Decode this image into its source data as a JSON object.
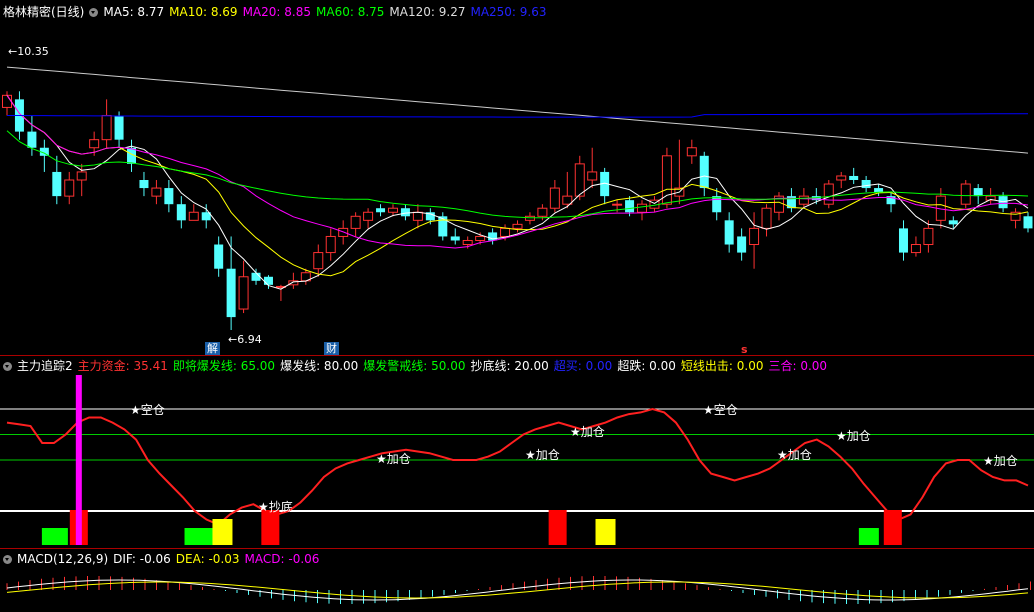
{
  "colors": {
    "bg": "#000000",
    "up": "#ff3232",
    "down": "#54ffff",
    "ma5": "#ffffff",
    "ma10": "#ffff00",
    "ma20": "#ff00ff",
    "ma60": "#00ff00",
    "ma120": "#cccccc",
    "ma250": "#0000ff",
    "divider": "#aa0000"
  },
  "main_header": {
    "name": "格林精密(日线)",
    "ma5": "MA5: 8.77",
    "ma10": "MA10: 8.69",
    "ma20": "MA20: 8.85",
    "ma60": "MA60: 8.75",
    "ma120": "MA120: 9.27",
    "ma250": "MA250: 9.63"
  },
  "main_labels": {
    "high": "10.35",
    "low": "6.94",
    "tag1": "解",
    "tag2": "财",
    "tag3": "s"
  },
  "ind_header": {
    "name": "主力追踪2",
    "zlzj": "主力资金: 35.41",
    "jjbfx": "即将爆发线: 65.00",
    "bfx": "爆发线: 80.00",
    "bfjjx": "爆发警戒线: 50.00",
    "cdx": "抄底线: 20.00",
    "cm": "超买: 0.00",
    "cd": "超跌: 0.00",
    "dxcj": "短线出击: 0.00",
    "sh": "三合: 0.00"
  },
  "macd_header": {
    "name": "MACD(12,26,9)",
    "dif": "DIF: -0.06",
    "dea": "DEA: -0.03",
    "macd": "MACD: -0.06"
  },
  "chart_data": [
    {
      "type": "candlestick",
      "title": "格林精密(日线)",
      "ylim": [
        6.94,
        10.35
      ],
      "candles": [
        [
          9.7,
          9.9,
          9.6,
          9.85
        ],
        [
          9.8,
          9.9,
          9.3,
          9.4
        ],
        [
          9.4,
          9.6,
          9.1,
          9.2
        ],
        [
          9.2,
          9.3,
          8.9,
          9.1
        ],
        [
          8.9,
          9.1,
          8.5,
          8.6
        ],
        [
          8.6,
          8.9,
          8.5,
          8.8
        ],
        [
          8.8,
          9.0,
          8.6,
          8.9
        ],
        [
          9.2,
          9.4,
          9.1,
          9.3
        ],
        [
          9.3,
          9.8,
          9.2,
          9.6
        ],
        [
          9.6,
          9.65,
          9.2,
          9.3
        ],
        [
          9.2,
          9.3,
          8.9,
          9.0
        ],
        [
          8.8,
          8.9,
          8.6,
          8.7
        ],
        [
          8.6,
          8.8,
          8.5,
          8.7
        ],
        [
          8.7,
          8.8,
          8.4,
          8.5
        ],
        [
          8.5,
          8.6,
          8.2,
          8.3
        ],
        [
          8.3,
          8.5,
          8.3,
          8.4
        ],
        [
          8.4,
          8.5,
          8.2,
          8.3
        ],
        [
          8.0,
          8.1,
          7.6,
          7.7
        ],
        [
          7.7,
          8.1,
          6.94,
          7.1
        ],
        [
          7.2,
          7.8,
          7.15,
          7.6
        ],
        [
          7.65,
          7.7,
          7.5,
          7.55
        ],
        [
          7.6,
          7.62,
          7.45,
          7.5
        ],
        [
          7.48,
          7.5,
          7.3,
          7.48
        ],
        [
          7.5,
          7.65,
          7.45,
          7.55
        ],
        [
          7.55,
          7.7,
          7.5,
          7.65
        ],
        [
          7.7,
          8.0,
          7.6,
          7.9
        ],
        [
          7.9,
          8.2,
          7.8,
          8.1
        ],
        [
          8.1,
          8.3,
          8.0,
          8.2
        ],
        [
          8.2,
          8.4,
          8.1,
          8.35
        ],
        [
          8.3,
          8.45,
          8.2,
          8.4
        ],
        [
          8.45,
          8.5,
          8.35,
          8.4
        ],
        [
          8.4,
          8.5,
          8.35,
          8.45
        ],
        [
          8.45,
          8.5,
          8.3,
          8.35
        ],
        [
          8.3,
          8.5,
          8.2,
          8.4
        ],
        [
          8.4,
          8.45,
          8.25,
          8.3
        ],
        [
          8.35,
          8.4,
          8.05,
          8.1
        ],
        [
          8.1,
          8.2,
          8.0,
          8.05
        ],
        [
          8.0,
          8.1,
          7.95,
          8.05
        ],
        [
          8.05,
          8.15,
          8.0,
          8.1
        ],
        [
          8.15,
          8.2,
          8.0,
          8.05
        ],
        [
          8.1,
          8.25,
          8.05,
          8.2
        ],
        [
          8.2,
          8.3,
          8.15,
          8.25
        ],
        [
          8.3,
          8.4,
          8.25,
          8.35
        ],
        [
          8.35,
          8.5,
          8.3,
          8.45
        ],
        [
          8.45,
          8.8,
          8.4,
          8.7
        ],
        [
          8.5,
          8.9,
          8.45,
          8.6
        ],
        [
          8.6,
          9.1,
          8.55,
          9.0
        ],
        [
          8.8,
          9.2,
          8.7,
          8.9
        ],
        [
          8.9,
          8.95,
          8.5,
          8.6
        ],
        [
          8.5,
          8.55,
          8.4,
          8.5
        ],
        [
          8.55,
          8.6,
          8.35,
          8.4
        ],
        [
          8.4,
          8.55,
          8.3,
          8.5
        ],
        [
          8.45,
          8.6,
          8.4,
          8.55
        ],
        [
          8.5,
          9.2,
          8.45,
          9.1
        ],
        [
          8.6,
          9.3,
          8.5,
          8.7
        ],
        [
          9.1,
          9.3,
          9.0,
          9.2
        ],
        [
          9.1,
          9.15,
          8.6,
          8.7
        ],
        [
          8.6,
          8.7,
          8.3,
          8.4
        ],
        [
          8.3,
          8.4,
          7.9,
          8.0
        ],
        [
          8.1,
          8.2,
          7.8,
          7.9
        ],
        [
          8.0,
          8.4,
          7.7,
          8.2
        ],
        [
          8.2,
          8.5,
          8.1,
          8.45
        ],
        [
          8.4,
          8.65,
          8.3,
          8.6
        ],
        [
          8.6,
          8.7,
          8.4,
          8.45
        ],
        [
          8.5,
          8.7,
          8.45,
          8.6
        ],
        [
          8.6,
          8.7,
          8.5,
          8.55
        ],
        [
          8.5,
          8.8,
          8.45,
          8.75
        ],
        [
          8.8,
          8.9,
          8.7,
          8.85
        ],
        [
          8.85,
          8.95,
          8.75,
          8.8
        ],
        [
          8.8,
          8.85,
          8.65,
          8.7
        ],
        [
          8.7,
          8.75,
          8.6,
          8.65
        ],
        [
          8.6,
          8.65,
          8.4,
          8.5
        ],
        [
          8.2,
          8.3,
          7.8,
          7.9
        ],
        [
          7.9,
          8.1,
          7.85,
          8.0
        ],
        [
          8.0,
          8.3,
          7.9,
          8.2
        ],
        [
          8.3,
          8.7,
          8.2,
          8.6
        ],
        [
          8.3,
          8.35,
          8.2,
          8.25
        ],
        [
          8.5,
          8.8,
          8.45,
          8.75
        ],
        [
          8.7,
          8.75,
          8.5,
          8.6
        ],
        [
          8.55,
          8.7,
          8.5,
          8.6
        ],
        [
          8.6,
          8.65,
          8.4,
          8.45
        ],
        [
          8.3,
          8.45,
          8.2,
          8.4
        ],
        [
          8.35,
          8.4,
          8.15,
          8.2
        ]
      ]
    },
    {
      "type": "line",
      "title": "主力追踪2",
      "ylim": [
        0,
        100
      ],
      "reference_lines": [
        80,
        65,
        50,
        20
      ],
      "series": [
        {
          "name": "主力资金",
          "values": [
            72,
            71,
            70,
            60,
            60,
            65,
            72,
            75,
            75,
            72,
            68,
            62,
            50,
            42,
            35,
            28,
            20,
            15,
            12,
            18,
            22,
            24,
            20,
            18,
            20,
            25,
            32,
            40,
            45,
            48,
            50,
            52,
            54,
            55,
            56,
            55,
            54,
            52,
            50,
            50,
            50,
            52,
            55,
            60,
            65,
            68,
            70,
            72,
            70,
            68,
            70,
            72,
            75,
            77,
            78,
            80,
            78,
            72,
            62,
            50,
            42,
            40,
            38,
            40,
            42,
            45,
            50,
            55,
            60,
            62,
            58,
            52,
            45,
            36,
            28,
            20,
            15,
            18,
            28,
            40,
            48,
            50,
            50,
            44,
            40,
            38,
            38,
            35
          ]
        }
      ],
      "annotations": [
        "空仓",
        "抄底",
        "加仓",
        "加仓",
        "加仓",
        "空仓",
        "加仓",
        "加仓",
        "加仓"
      ]
    },
    {
      "type": "bar",
      "title": "MACD(12,26,9)",
      "series": [
        {
          "name": "DIF",
          "value": -0.06
        },
        {
          "name": "DEA",
          "value": -0.03
        },
        {
          "name": "MACD",
          "value": -0.06
        }
      ]
    }
  ]
}
